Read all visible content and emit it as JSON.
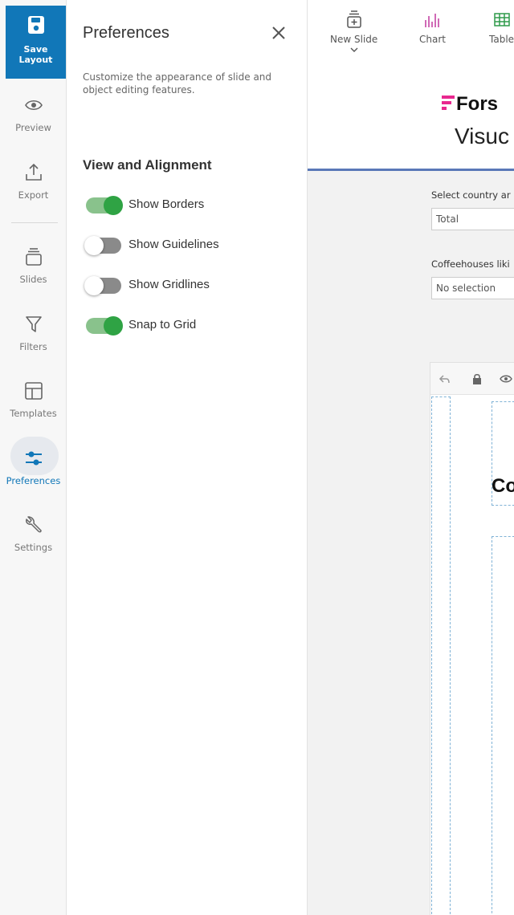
{
  "rail": {
    "save_label": "Save\nLayout",
    "items": [
      {
        "label": "Preview",
        "icon": "eye-icon"
      },
      {
        "label": "Export",
        "icon": "export-icon"
      },
      {
        "label": "Slides",
        "icon": "slides-icon"
      },
      {
        "label": "Filters",
        "icon": "filter-icon"
      },
      {
        "label": "Templates",
        "icon": "templates-icon"
      },
      {
        "label": "Preferences",
        "icon": "sliders-icon",
        "active": true
      },
      {
        "label": "Settings",
        "icon": "wrench-icon"
      }
    ]
  },
  "panel": {
    "title": "Preferences",
    "description": "Customize the appearance of slide and object editing features.",
    "section_title": "View and Alignment",
    "toggles": [
      {
        "label": "Show Borders",
        "on": true
      },
      {
        "label": "Show Guidelines",
        "on": false
      },
      {
        "label": "Show Gridlines",
        "on": false
      },
      {
        "label": "Snap to Grid",
        "on": true
      }
    ]
  },
  "toolbar": {
    "new_slide": "New Slide",
    "chart": "Chart",
    "table": "Table"
  },
  "canvas": {
    "logo_top": "Fors",
    "logo_bottom": "Visuc",
    "filter1_label": "Select country ar",
    "filter1_value": "Total",
    "filter2_label": "Coffeehouses liki",
    "filter2_value": "No selection",
    "slide_text": "Co"
  },
  "colors": {
    "accent": "#1177b8",
    "toggle_on": "#2fa344",
    "logo_magenta": "#e8288f"
  }
}
